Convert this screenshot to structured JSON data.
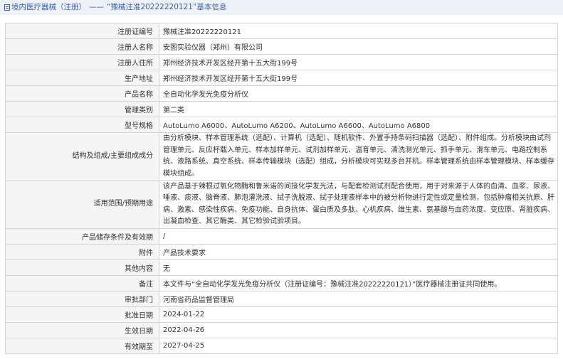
{
  "header": {
    "category": "境内医疗器械（注册）",
    "separator": "——",
    "title": "“豫械注准20222220121”基本信息"
  },
  "fields": [
    {
      "label": "注册证编号",
      "value": "豫械注准20222220121"
    },
    {
      "label": "注册人名称",
      "value": "安图实验仪器（郑州）有限公司"
    },
    {
      "label": "注册人住所",
      "value": "郑州经济技术开发区经开第十五大街199号"
    },
    {
      "label": "生产地址",
      "value": "郑州经济技术开发区经开第十五大街199号"
    },
    {
      "label": "产品名称",
      "value": "全自动化学发光免疫分析仪"
    },
    {
      "label": "管理类别",
      "value": "第二类"
    },
    {
      "label": "型号规格",
      "value": "AutoLumo A6000、AutoLumo A6200、AutoLumo A6600、AutoLumo A6800"
    },
    {
      "label": "结构及组成/主要组成成分",
      "value": "由分析模块、样本管理系统（选配）、计算机（选配）、随机软件、外置手持条码扫描器（选配）、附件组成。分析模块由试剂管理单元、反应杯载入单元、样本加样单元、试剂加样单元、温育单元、清洗测光单元、抓手单元、滑车单元、电路控制系统、液路系统、真空系统、样本传输模块（选配）组成，分析模块可实现多台并机。样本管理系统由样本管理模块、样本缓存模块组成。"
    },
    {
      "label": "适用范围/预期用途",
      "value": "该产品基于辣根过氧化物酶和鲁米诺的间接化学发光法，与配套检测试剂配合使用，用于对来源于人体的血清、血浆、尿液、唾液、痰液、脑脊液、肺泡灌洗液、拭子洗脱液、拭子处理液样本中的被分析物进行定性或定量检测，包括肿瘤相关抗原、肝病、激素、感染性疾病、免疫功能、自身抗体、蛋白质及多肽、心机疾病、维生素、氨基酸与血药浓度、变应原、肾脏疾病、出凝血检查、其它酶类、其它检验试验项目。"
    },
    {
      "label": "产品储存条件及有效期",
      "value": "/"
    },
    {
      "label": "附件",
      "value": "产品技术要求"
    },
    {
      "label": "其他内容",
      "value": "无"
    },
    {
      "label": "备注",
      "value": "本文件与“全自动化学发光免疫分析仪（注册证编号：豫械注准20222220121）”医疗器械注册证共同使用。"
    },
    {
      "label": "审批部门",
      "value": "河南省药品监督管理局"
    },
    {
      "label": "批准日期",
      "value": "2024-01-22"
    },
    {
      "label": "生效日期",
      "value": "2022-04-26"
    },
    {
      "label": "有效期至",
      "value": "2027-04-25"
    }
  ]
}
